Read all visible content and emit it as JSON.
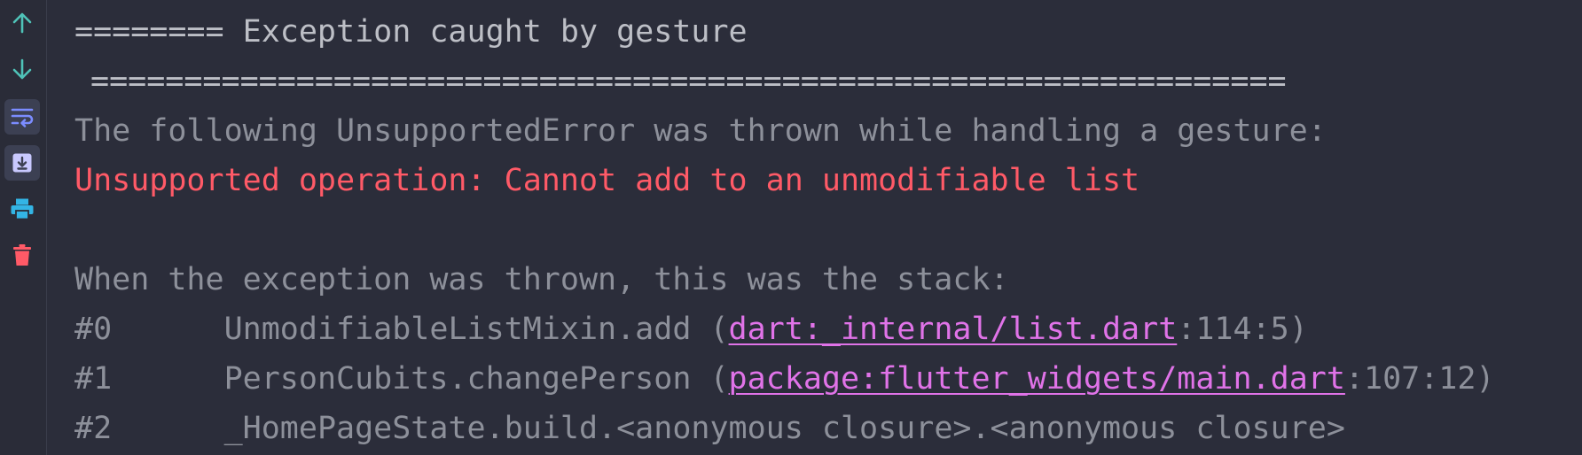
{
  "toolbar": {
    "icons": [
      {
        "name": "scroll-up-icon",
        "color": "#4fc3b8"
      },
      {
        "name": "scroll-down-icon",
        "color": "#4fc3b8"
      },
      {
        "name": "soft-wrap-icon",
        "color": "#7b8cff"
      },
      {
        "name": "scroll-to-end-icon",
        "color": "#c9c9ff"
      },
      {
        "name": "print-icon",
        "color": "#33b5e5"
      },
      {
        "name": "clear-icon",
        "color": "#ff5a67"
      }
    ]
  },
  "console": {
    "header_line1": "======== Exception caught by gesture",
    "header_line2": "================================================================",
    "intro": "The following UnsupportedError was thrown while handling a gesture:",
    "error_message": "Unsupported operation: Cannot add to an unmodifiable list",
    "stack_heading": "When the exception was thrown, this was the stack:",
    "frames": [
      {
        "index": "#0",
        "spacing": "      ",
        "method": "UnmodifiableListMixin.add (",
        "link": "dart:_internal/list.dart",
        "location": ":114:5)"
      },
      {
        "index": "#1",
        "spacing": "      ",
        "method": "PersonCubits.changePerson (",
        "link": "package:flutter_widgets/main.dart",
        "location": ":107:12)"
      },
      {
        "index": "#2",
        "spacing": "      ",
        "method": "_HomePageState.build.<anonymous closure>.<anonymous closure>",
        "link": "",
        "location": ""
      }
    ]
  },
  "colors": {
    "background": "#2b2d3a",
    "error_text": "#ff5a67",
    "link_text": "#e073e8",
    "muted_text": "#8d909a"
  }
}
